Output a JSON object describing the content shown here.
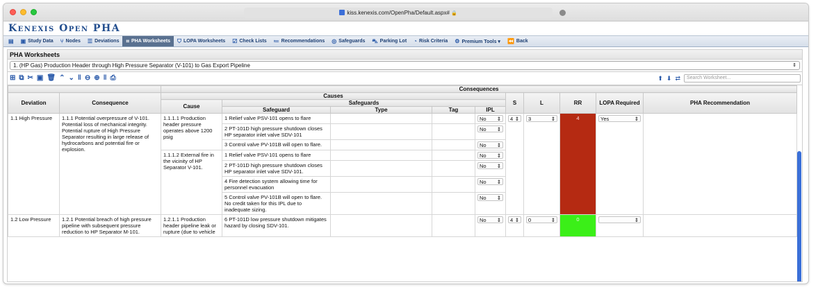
{
  "browser": {
    "url": "kiss.kenexis.com/OpenPha/Default.aspx#"
  },
  "app": {
    "brand": "Kenexis Open PHA"
  },
  "nav": [
    {
      "label": "",
      "icon": "dashboard-icon",
      "glyph": "▤"
    },
    {
      "label": "Study Data",
      "icon": "clipboard-icon",
      "glyph": "▣"
    },
    {
      "label": "Nodes",
      "icon": "nodes-icon",
      "glyph": "⑂"
    },
    {
      "label": "Deviations",
      "icon": "list-icon",
      "glyph": "☰"
    },
    {
      "label": "PHA Worksheets",
      "icon": "grid-icon",
      "glyph": "⌗",
      "active": true
    },
    {
      "label": "LOPA Worksheets",
      "icon": "shield-icon",
      "glyph": "⛉"
    },
    {
      "label": "Check Lists",
      "icon": "checkbox-icon",
      "glyph": "☑"
    },
    {
      "label": "Recommendations",
      "icon": "bullet-list-icon",
      "glyph": "≔"
    },
    {
      "label": "Safeguards",
      "icon": "lifebuoy-icon",
      "glyph": "◎"
    },
    {
      "label": "Parking Lot",
      "icon": "car-icon",
      "glyph": "⛍"
    },
    {
      "label": "Risk Criteria",
      "icon": "gauge-icon",
      "glyph": "◔"
    },
    {
      "label": "Premium Tools ▾",
      "icon": "gears-icon",
      "glyph": "⚙"
    },
    {
      "label": "Back",
      "icon": "back-icon",
      "glyph": "⏪"
    }
  ],
  "worksheet": {
    "section_title": "PHA Worksheets",
    "selected_node": "1. (HP Gas) Production Header through High Pressure Separator (V-101) to Gas Export Pipeline",
    "search_placeholder": "Search Worksheet..."
  },
  "toolbar_icons": [
    "add-icon",
    "copy-icon",
    "cut-icon",
    "paste-icon",
    "delete-icon",
    "move-up-icon",
    "move-down-icon",
    "zoom-out-icon",
    "zoom-in-icon",
    "print-icon"
  ],
  "columns": {
    "consequences_group": "Consequences",
    "causes_group": "Causes",
    "safeguards_group": "Safeguards",
    "deviation": "Deviation",
    "consequence": "Consequence",
    "cause": "Cause",
    "safeguard": "Safeguard",
    "type": "Type",
    "tag": "Tag",
    "ipl": "IPL",
    "s": "S",
    "l": "L",
    "rr": "RR",
    "lopa_required": "LOPA Required",
    "recommendation": "PHA Recommendation"
  },
  "rows": [
    {
      "deviation": "1.1 High Pressure",
      "consequence": "1.1.1 Potential overpressure of V-101.  Potential loss of mechanical integrity.  Potential rupture of High Pressure Separator resulting in large release of hydrocarbons and potential fire or explosion.",
      "s": "4",
      "l": "3",
      "rr": "4",
      "rr_color": "red",
      "lopa": "Yes",
      "causes": [
        {
          "cause": "1.1.1.1 Production header pressure operates above 1200 psig",
          "safeguards": [
            {
              "text": "1 Relief valve PSV-101 opens to flare",
              "ipl": "No"
            },
            {
              "text": "2 PT-101D high pressure shutdown closes HP separator inlet valve SDV-101",
              "ipl": "No"
            },
            {
              "text": "3 Control valve PV-101B will open to flare.",
              "ipl": "No"
            }
          ]
        },
        {
          "cause": "1.1.1.2 External fire in the vicinity of HP Separator V-101.",
          "safeguards": [
            {
              "text": "1 Relief valve PSV-101 opens to flare",
              "ipl": "No"
            },
            {
              "text": "2 PT-101D high pressure shutdown closes HP separator inlet valve SDV-101.",
              "ipl": "No"
            },
            {
              "text": "4 Fire detection system allowing time for personnel evacuation",
              "ipl": "No"
            },
            {
              "text": "5 Control valve PV-101B will open to flare. No credit taken for this IPL due to inadequate sizing.",
              "ipl": "No"
            }
          ]
        }
      ]
    },
    {
      "deviation": "1.2 Low Pressure",
      "consequence": "1.2.1 Potential breach of high pressure pipeline with subsequent pressure reduction to HP Separator M-101.",
      "s": "4",
      "l": "0",
      "rr": "0",
      "rr_color": "green",
      "lopa": "",
      "causes": [
        {
          "cause": "1.2.1.1 Production header pipeline leak or rupture (due to vehicle",
          "safeguards": [
            {
              "text": "6 PT-101D low pressure shutdown mitigates hazard by closing SDV-101.",
              "ipl": "No"
            }
          ]
        }
      ]
    }
  ]
}
